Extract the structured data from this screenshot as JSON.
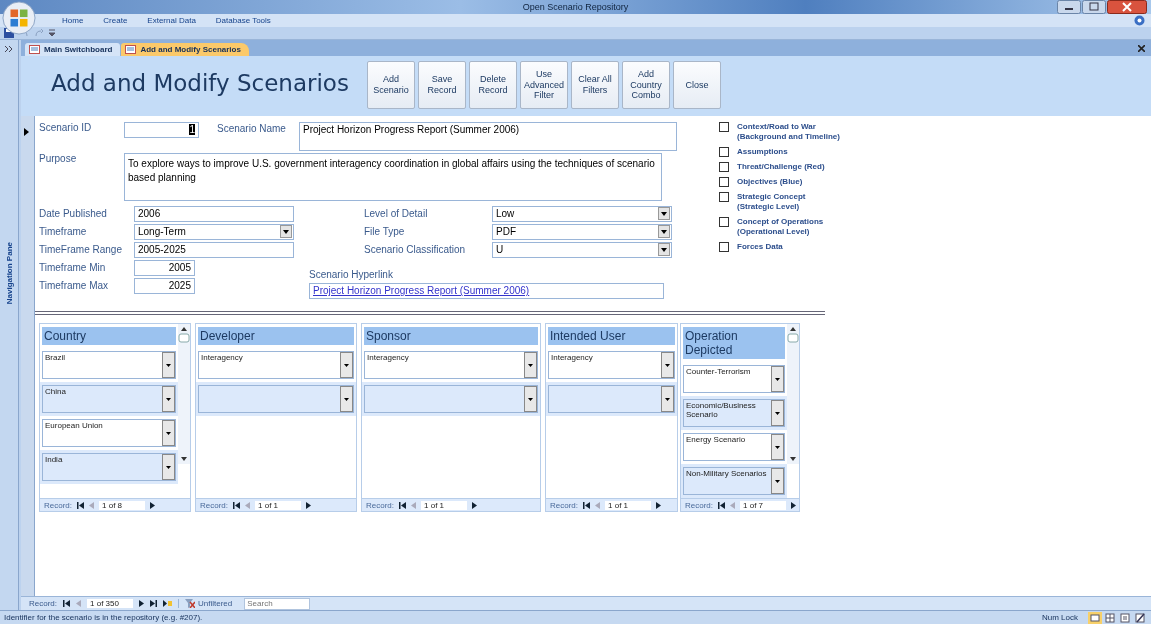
{
  "window": {
    "title": "Open Scenario Repository"
  },
  "ribbon_tabs": [
    "Home",
    "Create",
    "External Data",
    "Database Tools"
  ],
  "nav_pane": {
    "label": "Navigation Pane"
  },
  "doc_tabs": [
    {
      "label": "Main Switchboard",
      "selected": false
    },
    {
      "label": "Add and Modify Scenarios",
      "selected": true
    }
  ],
  "form": {
    "title": "Add and Modify Scenarios",
    "buttons": [
      "Add Scenario",
      "Save Record",
      "Delete Record",
      "Use Advanced Filter",
      "Clear All Filters",
      "Add Country Combo",
      "Close"
    ],
    "scenario_id": {
      "label": "Scenario ID",
      "value": "1"
    },
    "scenario_name": {
      "label": "Scenario Name",
      "value": "Project Horizon Progress Report (Summer 2006)"
    },
    "purpose": {
      "label": "Purpose",
      "value": "To explore ways to improve U.S. government interagency coordination in global affairs using the techniques of scenario based planning"
    },
    "left_fields": [
      {
        "label": "Date Published",
        "value": "2006",
        "kind": "text"
      },
      {
        "label": "Timeframe",
        "value": "Long-Term",
        "kind": "combo"
      },
      {
        "label": "TimeFrame Range",
        "value": "2005-2025",
        "kind": "text"
      },
      {
        "label": "Timeframe Min",
        "value": "2005",
        "kind": "number"
      },
      {
        "label": "Timeframe Max",
        "value": "2025",
        "kind": "number"
      }
    ],
    "right_fields": [
      {
        "label": "Level of Detail",
        "value": "Low",
        "kind": "combo"
      },
      {
        "label": "File Type",
        "value": "PDF",
        "kind": "combo"
      },
      {
        "label": "Scenario Classification",
        "value": "U",
        "kind": "combo"
      }
    ],
    "hyperlink": {
      "label": "Scenario Hyperlink",
      "value": "Project Horizon Progress Report (Summer 2006)"
    },
    "checkboxes": [
      {
        "label": "Context/Road to War\n(Background and Timeline)",
        "checked": false
      },
      {
        "label": "Assumptions",
        "checked": false
      },
      {
        "label": "Threat/Challenge (Red)",
        "checked": false
      },
      {
        "label": "Objectives (Blue)",
        "checked": false
      },
      {
        "label": "Strategic Concept\n (Strategic Level)",
        "checked": false
      },
      {
        "label": "Concept of Operations\n(Operational Level)",
        "checked": false
      },
      {
        "label": "Forces Data",
        "checked": false
      }
    ],
    "subforms": [
      {
        "title": "Country",
        "rows": [
          "Brazil",
          "China",
          "European Union",
          "India"
        ],
        "new_row": false,
        "scrollbar": true,
        "nav_label": "Record:",
        "position": "1 of 8"
      },
      {
        "title": "Developer",
        "rows": [
          "Interagency"
        ],
        "new_row": true,
        "scrollbar": false,
        "nav_label": "Record:",
        "position": "1 of 1"
      },
      {
        "title": "Sponsor",
        "rows": [
          "Interagency"
        ],
        "new_row": true,
        "scrollbar": false,
        "nav_label": "Record:",
        "position": "1 of 1"
      },
      {
        "title": "Intended User",
        "rows": [
          "Interagency"
        ],
        "new_row": true,
        "scrollbar": false,
        "nav_label": "Record:",
        "position": "1 of 1"
      },
      {
        "title": "Operation Depicted",
        "rows": [
          "Counter-Terrorism",
          "Economic/Business Scenario",
          "Energy Scenario",
          "Non-Military Scenarios"
        ],
        "new_row": false,
        "scrollbar": true,
        "nav_label": "Record:",
        "position": "1 of 7"
      }
    ]
  },
  "record_nav": {
    "label": "Record:",
    "position": "1 of 350",
    "filter": "Unfiltered",
    "search_placeholder": "Search"
  },
  "status_bar": {
    "message": "Identifier for the scenario is in the repository (e.g. #207).",
    "num_lock": "Num Lock"
  }
}
